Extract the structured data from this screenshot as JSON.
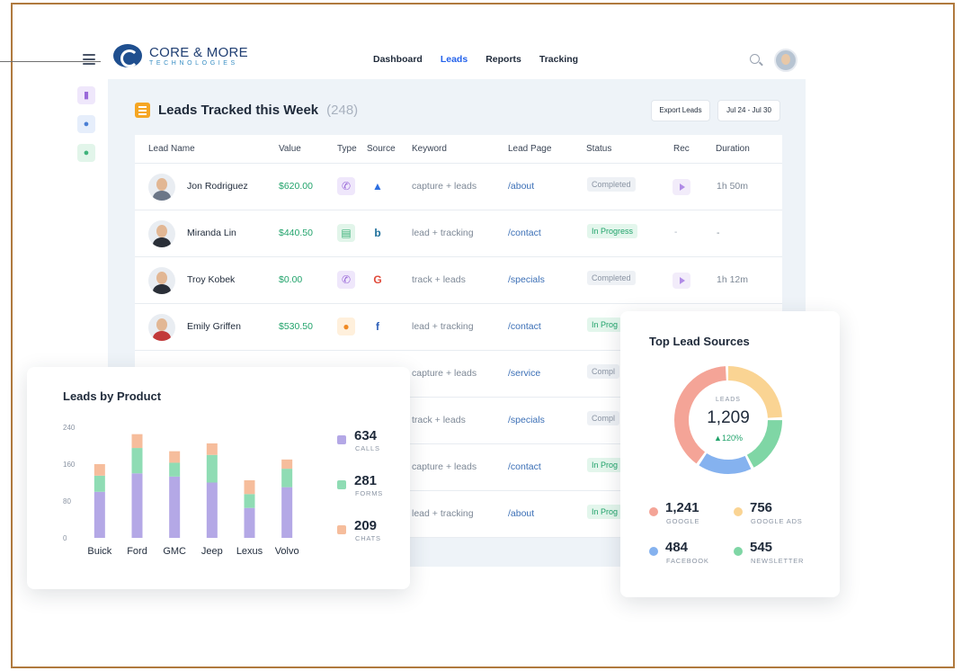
{
  "brand": {
    "name": "CORE & MORE",
    "tagline": "TECHNOLOGIES"
  },
  "nav": {
    "items": [
      "Dashboard",
      "Leads",
      "Reports",
      "Tracking"
    ],
    "active": "Leads"
  },
  "leads": {
    "title": "Leads Tracked this Week",
    "count": "(248)",
    "export_label": "Export Leads",
    "date_range": "Jul 24 - Jul 30",
    "columns": [
      "Lead Name",
      "Value",
      "Type",
      "Source",
      "Keyword",
      "Lead Page",
      "Status",
      "Rec",
      "Duration"
    ],
    "rows": [
      {
        "name": "Jon Rodriguez",
        "value": "$620.00",
        "type": "call",
        "source": "Google Ads",
        "keyword": "capture + leads",
        "page": "/about",
        "status": "Completed",
        "rec": true,
        "duration": "1h 50m"
      },
      {
        "name": "Miranda Lin",
        "value": "$440.50",
        "type": "form",
        "source": "Bing",
        "keyword": "lead + tracking",
        "page": "/contact",
        "status": "In Progress",
        "rec": false,
        "rec_text": "-",
        "duration": "-"
      },
      {
        "name": "Troy Kobek",
        "value": "$0.00",
        "type": "call",
        "source": "Google",
        "keyword": "track + leads",
        "page": "/specials",
        "status": "Completed",
        "rec": true,
        "duration": "1h 12m"
      },
      {
        "name": "Emily Griffen",
        "value": "$530.50",
        "type": "chat",
        "source": "Facebook",
        "keyword": "lead + tracking",
        "page": "/contact",
        "status": "In Prog",
        "rec": false,
        "duration": ""
      },
      {
        "name": "",
        "value": "",
        "type": "",
        "source": "",
        "keyword": "capture + leads",
        "page": "/service",
        "status": "Compl",
        "rec": false,
        "duration": ""
      },
      {
        "name": "",
        "value": "",
        "type": "",
        "source": "",
        "keyword": "track + leads",
        "page": "/specials",
        "status": "Compl",
        "rec": false,
        "duration": ""
      },
      {
        "name": "",
        "value": "",
        "type": "",
        "source": "",
        "keyword": "capture + leads",
        "page": "/contact",
        "status": "In Prog",
        "rec": false,
        "duration": ""
      },
      {
        "name": "",
        "value": "",
        "type": "",
        "source": "",
        "keyword": "lead + tracking",
        "page": "/about",
        "status": "In Prog",
        "rec": false,
        "duration": ""
      }
    ],
    "icons": {
      "call": "phone-icon",
      "form": "form-icon",
      "chat": "chat-icon",
      "Google Ads": "google-ads-icon",
      "Bing": "bing-icon",
      "Google": "google-icon",
      "Facebook": "facebook-icon"
    }
  },
  "products_card": {
    "title": "Leads by Product",
    "legend": [
      {
        "value": "634",
        "label": "CALLS",
        "color": "#b4a8e6"
      },
      {
        "value": "281",
        "label": "FORMS",
        "color": "#8fdcb4"
      },
      {
        "value": "209",
        "label": "CHATS",
        "color": "#f6bd9c"
      }
    ]
  },
  "chart_data": {
    "type": "bar",
    "stacked": true,
    "categories": [
      "Buick",
      "Ford",
      "GMC",
      "Jeep",
      "Lexus",
      "Volvo"
    ],
    "series": [
      {
        "name": "CALLS",
        "color": "#b4a8e6",
        "values": [
          100,
          140,
          133,
          120,
          65,
          110
        ]
      },
      {
        "name": "FORMS",
        "color": "#8fdcb4",
        "values": [
          35,
          55,
          30,
          60,
          30,
          40
        ]
      },
      {
        "name": "CHATS",
        "color": "#f6bd9c",
        "values": [
          25,
          30,
          25,
          25,
          30,
          20
        ]
      }
    ],
    "yticks": [
      0,
      80,
      160,
      240
    ],
    "ylim": [
      0,
      240
    ],
    "grid": false
  },
  "sources_card": {
    "title": "Top Lead Sources",
    "center_label": "LEADS",
    "center_value": "1,209",
    "center_change": "▲120%",
    "segments": [
      {
        "name": "GOOGLE",
        "value": "1,241",
        "share": 0.4,
        "color": "#f4a497"
      },
      {
        "name": "GOOGLE ADS",
        "value": "756",
        "share": 0.25,
        "color": "#fad493"
      },
      {
        "name": "NEWSLETTER",
        "value": "545",
        "share": 0.18,
        "color": "#7fd6a5"
      },
      {
        "name": "FACEBOOK",
        "value": "484",
        "share": 0.17,
        "color": "#85b2ef"
      }
    ]
  },
  "colors": {
    "accent": "#2563eb",
    "value_green": "#21a36b",
    "completed_bg": "#eef1f5",
    "progress_bg": "#e3f6ec"
  }
}
